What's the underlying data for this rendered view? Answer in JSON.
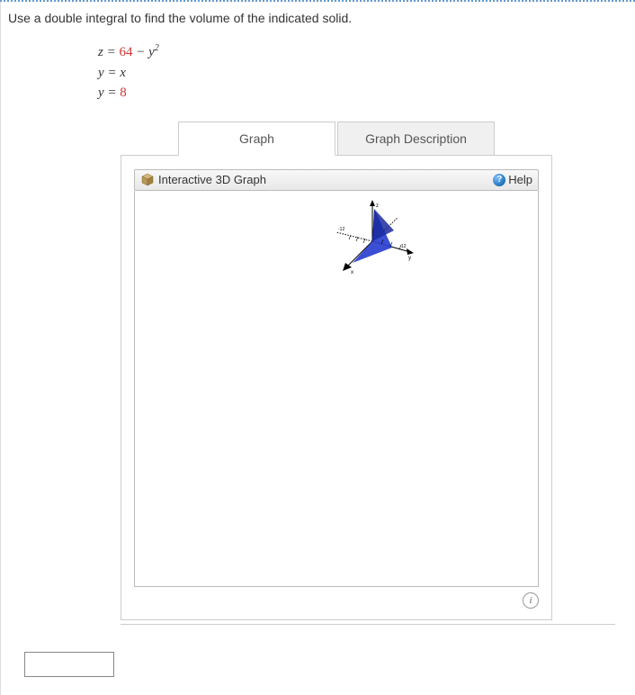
{
  "question": "Use a double integral to find the volume of the indicated solid.",
  "equations": {
    "eq1_lhs": "z",
    "eq1_c": "64",
    "eq1_var": "y",
    "eq1_exp": "2",
    "eq2": "y = x",
    "eq3_lhs": "y",
    "eq3_rhs": "8"
  },
  "tabs": {
    "graph": "Graph",
    "desc": "Graph Description"
  },
  "graph_panel": {
    "title": "Interactive 3D Graph",
    "help": "Help"
  },
  "chart_data": {
    "type": "3d-surface",
    "note": "Small 3D thumbnail showing a blue triangular/parabolic solid bounded above by z=64-y^2, with planes y=x and y=8, axes labeled x, y (values approx -12 to 12 visible)",
    "surfaces": [
      {
        "name": "z = 64 - y^2",
        "color": "#2a3fd0"
      },
      {
        "name": "y = x"
      },
      {
        "name": "y = 8"
      }
    ],
    "axes": {
      "x": [
        -12,
        12
      ],
      "y": [
        -12,
        12
      ],
      "z": [
        0,
        64
      ]
    }
  }
}
